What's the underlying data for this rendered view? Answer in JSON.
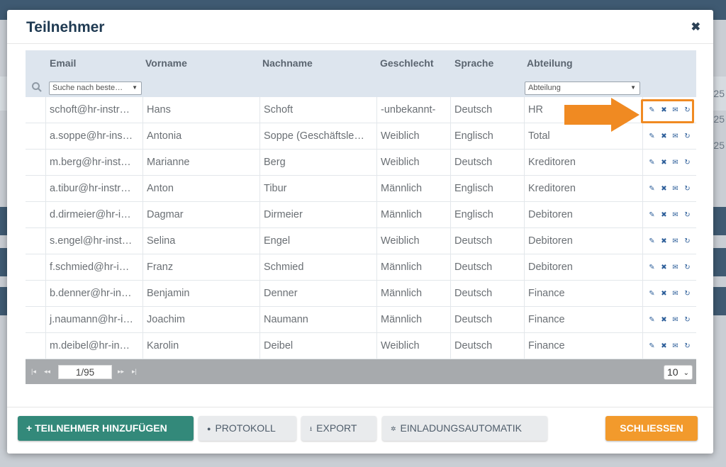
{
  "background": {
    "numbers": [
      "25",
      "25",
      "25"
    ]
  },
  "dialog": {
    "title": "Teilnehmer",
    "close_icon": "close-icon"
  },
  "table": {
    "columns": [
      "Email",
      "Vorname",
      "Nachname",
      "Geschlecht",
      "Sprache",
      "Abteilung"
    ],
    "filters": {
      "email_placeholder": "Suche nach beste…",
      "abteilung_placeholder": "Abteilung"
    },
    "rows": [
      {
        "email": "schoft@hr-instr…",
        "vorname": "Hans",
        "nachname": "Schoft",
        "geschlecht": "-unbekannt-",
        "sprache": "Deutsch",
        "abteilung": "HR"
      },
      {
        "email": "a.soppe@hr-ins…",
        "vorname": "Antonia",
        "nachname": "Soppe (Geschäftsle…",
        "geschlecht": "Weiblich",
        "sprache": "Englisch",
        "abteilung": "Total"
      },
      {
        "email": "m.berg@hr-inst…",
        "vorname": "Marianne",
        "nachname": "Berg",
        "geschlecht": "Weiblich",
        "sprache": "Deutsch",
        "abteilung": "Kreditoren"
      },
      {
        "email": "a.tibur@hr-instr…",
        "vorname": "Anton",
        "nachname": "Tibur",
        "geschlecht": "Männlich",
        "sprache": "Englisch",
        "abteilung": "Kreditoren"
      },
      {
        "email": "d.dirmeier@hr-i…",
        "vorname": "Dagmar",
        "nachname": "Dirmeier",
        "geschlecht": "Männlich",
        "sprache": "Englisch",
        "abteilung": "Debitoren"
      },
      {
        "email": "s.engel@hr-inst…",
        "vorname": "Selina",
        "nachname": "Engel",
        "geschlecht": "Weiblich",
        "sprache": "Deutsch",
        "abteilung": "Debitoren"
      },
      {
        "email": "f.schmied@hr-i…",
        "vorname": "Franz",
        "nachname": "Schmied",
        "geschlecht": "Männlich",
        "sprache": "Deutsch",
        "abteilung": "Debitoren"
      },
      {
        "email": "b.denner@hr-in…",
        "vorname": "Benjamin",
        "nachname": "Denner",
        "geschlecht": "Männlich",
        "sprache": "Deutsch",
        "abteilung": "Finance"
      },
      {
        "email": "j.naumann@hr-i…",
        "vorname": "Joachim",
        "nachname": "Naumann",
        "geschlecht": "Männlich",
        "sprache": "Deutsch",
        "abteilung": "Finance"
      },
      {
        "email": "m.deibel@hr-in…",
        "vorname": "Karolin",
        "nachname": "Deibel",
        "geschlecht": "Weiblich",
        "sprache": "Deutsch",
        "abteilung": "Finance"
      }
    ],
    "row_action_icons": [
      "pencil-icon",
      "delete-icon",
      "mail-icon",
      "reset-icon"
    ]
  },
  "pager": {
    "page": "1/95",
    "page_size": "10"
  },
  "footer": {
    "add_label": "+ TEILNEHMER HINZUFÜGEN",
    "protokoll_label": "PROTOKOLL",
    "export_label": "EXPORT",
    "einladung_label": "EINLADUNGSAUTOMATIK",
    "close_label": "SCHLIESSEN"
  },
  "colors": {
    "accent_teal": "#33897a",
    "accent_orange": "#f29a2c",
    "highlight_orange": "#f08a22",
    "header_navy": "#1f3a52"
  }
}
